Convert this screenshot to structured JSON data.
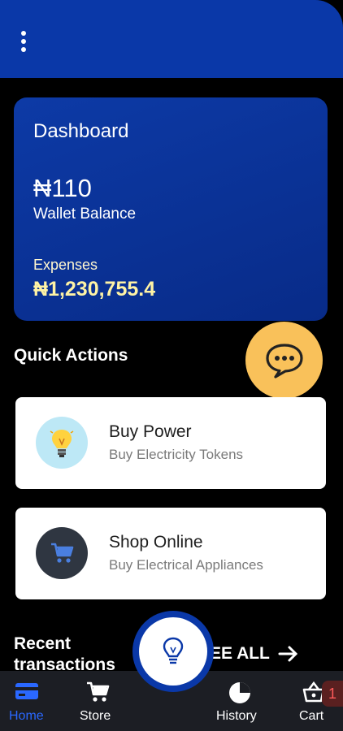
{
  "dashboard": {
    "title": "Dashboard",
    "balance": "₦110",
    "balance_label": "Wallet Balance",
    "expenses_label": "Expenses",
    "expenses_value": "₦1,230,755.4"
  },
  "quick_actions": {
    "title": "Quick Actions",
    "items": [
      {
        "title": "Buy Power",
        "subtitle": "Buy Electricity Tokens",
        "icon": "lightbulb-icon"
      },
      {
        "title": "Shop Online",
        "subtitle": "Buy Electrical Appliances",
        "icon": "cart-icon"
      }
    ]
  },
  "recent": {
    "title_line1": "Recent",
    "title_line2": "transactions",
    "see_all": "EE ALL"
  },
  "nav": {
    "items": [
      {
        "label": "Home",
        "icon": "card-icon",
        "active": true
      },
      {
        "label": "Store",
        "icon": "cart-icon"
      },
      {
        "label": "History",
        "icon": "pie-chart-icon"
      },
      {
        "label": "Cart",
        "icon": "basket-icon"
      }
    ],
    "cart_badge": "1"
  },
  "colors": {
    "primary": "#0a38a8",
    "accent_yellow": "#f9c15a",
    "expenses_text": "#fff3a5",
    "nav_bg": "#1c1e24",
    "active_nav": "#2a68ff"
  }
}
